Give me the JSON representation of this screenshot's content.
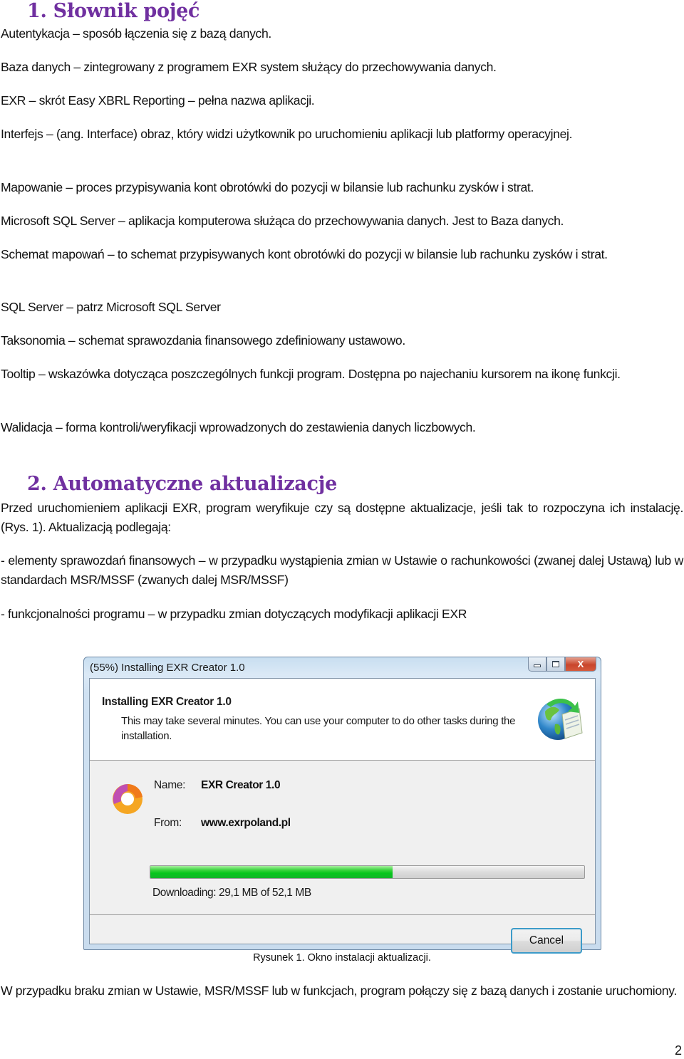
{
  "section1": {
    "heading": "1. Słownik pojęć",
    "definitions": [
      "Autentykacja – sposób łączenia się z bazą danych.",
      "Baza danych – zintegrowany z programem EXR system służący do przechowywania danych.",
      "EXR – skrót Easy XBRL Reporting – pełna nazwa aplikacji.",
      "Interfejs – (ang. Interface) obraz, który widzi użytkownik po uruchomieniu aplikacji lub platformy operacyjnej.",
      "Mapowanie – proces przypisywania kont obrotówki do pozycji w bilansie lub rachunku zysków i strat.",
      "Microsoft SQL Server – aplikacja komputerowa służąca do przechowywania danych. Jest to Baza danych.",
      "Schemat mapowań – to schemat przypisywanych kont obrotówki do pozycji w bilansie lub rachunku zysków i strat.",
      "SQL Server – patrz Microsoft SQL Server",
      "Taksonomia – schemat sprawozdania finansowego zdefiniowany ustawowo.",
      "Tooltip – wskazówka dotycząca poszczególnych funkcji program. Dostępna po najechaniu kursorem na ikonę funkcji.",
      "Walidacja – forma kontroli/weryfikacji wprowadzonych do zestawienia danych liczbowych."
    ]
  },
  "section2": {
    "heading": "2. Automatyczne aktualizacje",
    "intro": "Przed uruchomieniem aplikacji EXR, program weryfikuje czy są dostępne aktualizacje, jeśli tak to rozpoczyna ich instalację. (Rys. 1). Aktualizacją podlegają:",
    "bullets": [
      "- elementy sprawozdań finansowych – w przypadku wystąpienia zmian w Ustawie o rachunkowości (zwanej dalej Ustawą) lub w standardach MSR/MSSF (zwanych dalej MSR/MSSF)",
      "- funkcjonalności programu – w przypadku zmian dotyczących modyfikacji aplikacji EXR"
    ],
    "closing": "W przypadku braku zmian w Ustawie, MSR/MSSF lub w funkcjach, program połączy się z bazą danych i zostanie uruchomiony."
  },
  "installer": {
    "window_title": "(55%) Installing EXR Creator 1.0",
    "close_glyph": "X",
    "header_title": "Installing EXR Creator 1.0",
    "header_desc": "This may take several minutes. You can use your computer to do other tasks during the installation.",
    "name_label": "Name:",
    "name_value": "EXR Creator 1.0",
    "from_label": "From:",
    "from_value": "www.exrpoland.pl",
    "progress_fraction": 0.559,
    "status": "Downloading: 29,1 MB of 52,1 MB",
    "cancel_label": "Cancel",
    "icons": {
      "header": "globe-download-icon",
      "app": "exr-app-icon"
    }
  },
  "figure": {
    "caption": "Rysunek 1. Okno instalacji aktualizacji."
  },
  "page": {
    "number": "2"
  },
  "colors": {
    "heading": "#7030a0",
    "progress": "#06c61c",
    "cancel_border": "#3c9bc9"
  }
}
